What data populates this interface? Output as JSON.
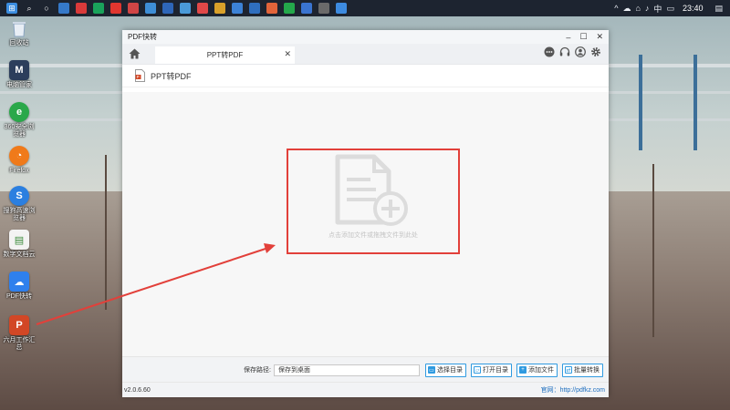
{
  "taskbar": {
    "clock": "23:40",
    "tray_lang": "中"
  },
  "desktop_icons": [
    {
      "label": "回收站"
    },
    {
      "label": "电脑管家"
    },
    {
      "label": "360安全浏览器"
    },
    {
      "label": "Firefox"
    },
    {
      "label": "搜狗高速浏览器"
    },
    {
      "label": "数字文档云"
    },
    {
      "label": "PDF快转"
    },
    {
      "label": "六月工作汇总"
    }
  ],
  "app": {
    "title": "PDF快转",
    "tab_label": "PPT转PDF",
    "section_title": "PPT转PDF",
    "drop_hint": "点击添加文件或拖拽文件到此处",
    "save_path_label": "保存路径:",
    "save_path_value": "保存到桌面",
    "buttons": {
      "select_dir": "选择目录",
      "open_dir": "打开目录",
      "add_file": "添加文件",
      "batch_convert": "批量转换"
    },
    "version": "v2.0.6.60",
    "website": "官网：http://pdfkz.com"
  },
  "colors": {
    "accent": "#2f9ae0",
    "highlight_box": "#e2403a",
    "website_link": "#1f6fbf"
  },
  "icons": [
    "home-icon",
    "chat-icon",
    "headset-icon",
    "user-icon",
    "gear-icon",
    "document-plus-icon",
    "ppt-file-icon",
    "folder-icon"
  ]
}
